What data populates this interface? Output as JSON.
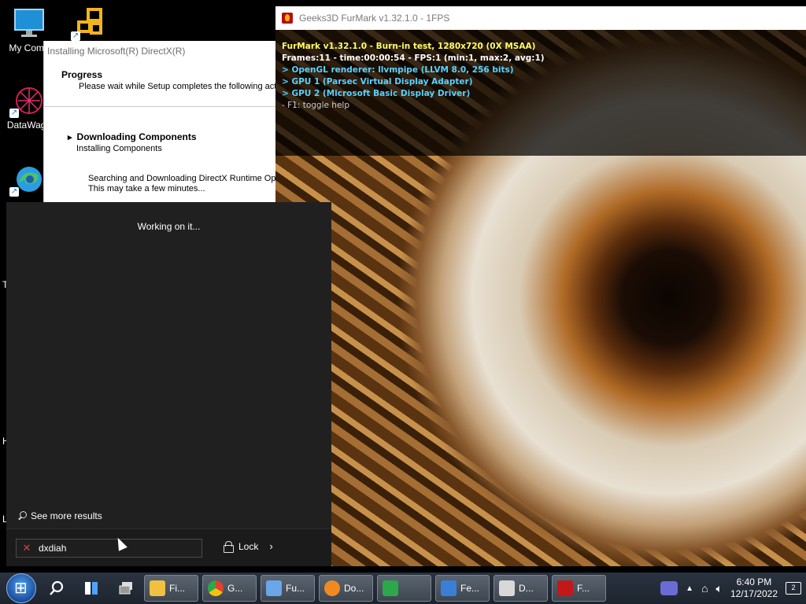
{
  "desktop": {
    "icons": [
      {
        "label": "My Comp",
        "icon": "monitor-icon"
      },
      {
        "label": "",
        "icon": "app-grid-icon"
      },
      {
        "label": "DataWago",
        "icon": "datawagon-icon"
      },
      {
        "label": "",
        "icon": "edge-icon"
      }
    ],
    "partial_letters": [
      "T",
      "H",
      "L"
    ]
  },
  "directx_window": {
    "title": "Installing Microsoft(R) DirectX(R)",
    "progress_title": "Progress",
    "progress_subtitle": "Please wait while Setup completes the following actio",
    "step_title": "Downloading Components",
    "step_subtitle": "Installing Components",
    "status_line1": "Searching and Downloading DirectX Runtime Optio",
    "status_line2": "This may take a few minutes..."
  },
  "furmark_window": {
    "title": "Geeks3D FurMark v1.32.1.0 - 1FPS",
    "osd": [
      {
        "text": "FurMark v1.32.1.0 - Burn-in test, 1280x720 (0X MSAA)",
        "color": "yellow"
      },
      {
        "text": "Frames:11 - time:00:00:54 - FPS:1 (min:1, max:2, avg:1)",
        "color": "white"
      },
      {
        "text": "> OpenGL renderer: llvmpipe (LLVM 8.0, 256 bits)",
        "color": "cyan"
      },
      {
        "text": "> GPU 1 (Parsec Virtual Display Adapter)",
        "color": "cyan"
      },
      {
        "text": "> GPU 2 (Microsoft Basic Display Driver)",
        "color": "cyan"
      },
      {
        "text": "- F1: toggle help",
        "color": "gray"
      }
    ]
  },
  "search_panel": {
    "status": "Working on it...",
    "see_more": "See more results",
    "query": "dxdiah",
    "lock_label": "Lock"
  },
  "taskbar": {
    "buttons": [
      {
        "label": "Fi...",
        "icon": "folder-icon",
        "color": "#f0c040"
      },
      {
        "label": "G...",
        "icon": "chrome-icon",
        "color": "#e04030"
      },
      {
        "label": "Fu...",
        "icon": "notepad-icon",
        "color": "#6aa6e8"
      },
      {
        "label": "Do...",
        "icon": "download-icon",
        "color": "#f08a20"
      },
      {
        "label": "",
        "icon": "green-box-icon",
        "color": "#2aa84a"
      },
      {
        "label": "Fe...",
        "icon": "user-icon",
        "color": "#3a7fd6"
      },
      {
        "label": "D...",
        "icon": "dxdiag-icon",
        "color": "#d8d8d8"
      },
      {
        "label": "F...",
        "icon": "furmark-icon",
        "color": "#c21818"
      }
    ],
    "time": "6:40 PM",
    "date": "12/17/2022",
    "notification_count": "2"
  }
}
